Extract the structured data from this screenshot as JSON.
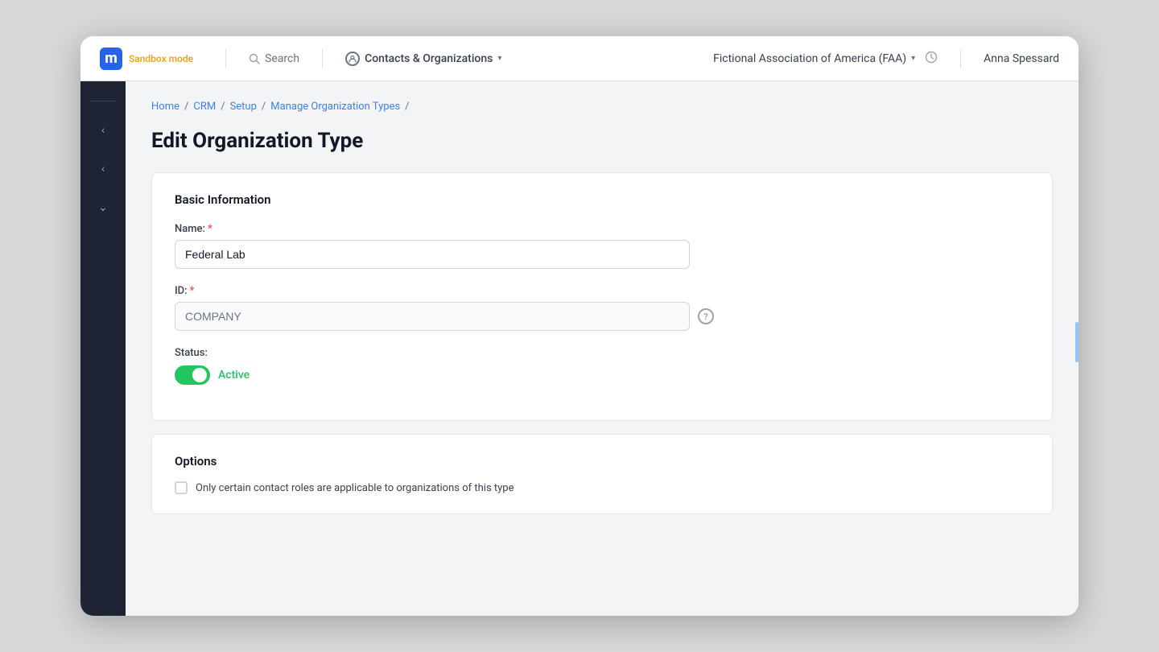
{
  "nav": {
    "logo_letter": "m",
    "sandbox_label": "Sandbox mode",
    "search_label": "Search",
    "contacts_label": "Contacts & Organizations",
    "org_name": "Fictional Association of America (FAA)",
    "user_name": "Anna Spessard"
  },
  "sidebar": {
    "chevron_left": "‹",
    "chevron_down": "∨"
  },
  "breadcrumb": {
    "home": "Home",
    "crm": "CRM",
    "setup": "Setup",
    "manage": "Manage Organization Types",
    "sep": "/"
  },
  "page": {
    "title": "Edit Organization Type"
  },
  "basic_info": {
    "section_title": "Basic Information",
    "name_label": "Name:",
    "name_required": "*",
    "name_value": "Federal Lab",
    "id_label": "ID:",
    "id_required": "*",
    "id_value": "COMPANY",
    "status_label": "Status:",
    "status_value": "Active"
  },
  "options": {
    "section_title": "Options",
    "checkbox_label": "Only certain contact roles are applicable to organizations of this type"
  }
}
